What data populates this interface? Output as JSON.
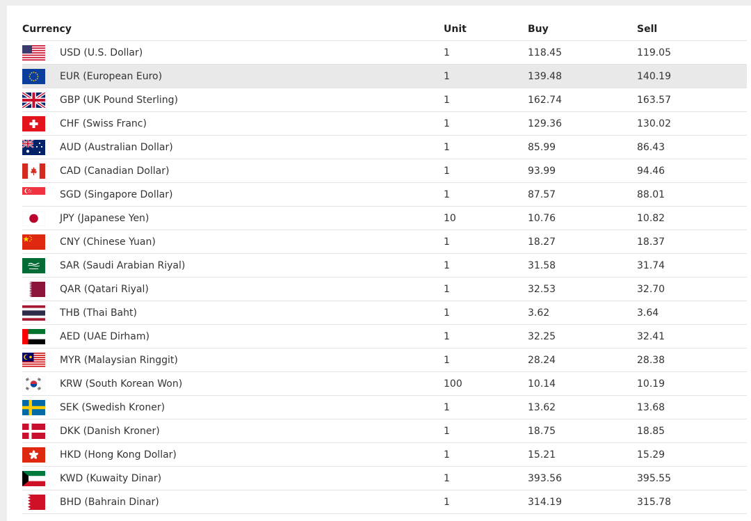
{
  "table": {
    "headers": {
      "currency": "Currency",
      "unit": "Unit",
      "buy": "Buy",
      "sell": "Sell"
    },
    "rows": [
      {
        "code": "usd",
        "currency": "USD (U.S. Dollar)",
        "unit": "1",
        "buy": "118.45",
        "sell": "119.05",
        "flag_icon": "us-flag-icon"
      },
      {
        "code": "eur",
        "currency": "EUR (European Euro)",
        "unit": "1",
        "buy": "139.48",
        "sell": "140.19",
        "flag_icon": "eu-flag-icon"
      },
      {
        "code": "gbp",
        "currency": "GBP (UK Pound Sterling)",
        "unit": "1",
        "buy": "162.74",
        "sell": "163.57",
        "flag_icon": "uk-flag-icon"
      },
      {
        "code": "chf",
        "currency": "CHF (Swiss Franc)",
        "unit": "1",
        "buy": "129.36",
        "sell": "130.02",
        "flag_icon": "swiss-flag-icon"
      },
      {
        "code": "aud",
        "currency": "AUD (Australian Dollar)",
        "unit": "1",
        "buy": "85.99",
        "sell": "86.43",
        "flag_icon": "australia-flag-icon"
      },
      {
        "code": "cad",
        "currency": "CAD (Canadian Dollar)",
        "unit": "1",
        "buy": "93.99",
        "sell": "94.46",
        "flag_icon": "canada-flag-icon"
      },
      {
        "code": "sgd",
        "currency": "SGD (Singapore Dollar)",
        "unit": "1",
        "buy": "87.57",
        "sell": "88.01",
        "flag_icon": "singapore-flag-icon"
      },
      {
        "code": "jpy",
        "currency": "JPY (Japanese Yen)",
        "unit": "10",
        "buy": "10.76",
        "sell": "10.82",
        "flag_icon": "japan-flag-icon"
      },
      {
        "code": "cny",
        "currency": "CNY (Chinese Yuan)",
        "unit": "1",
        "buy": "18.27",
        "sell": "18.37",
        "flag_icon": "china-flag-icon"
      },
      {
        "code": "sar",
        "currency": "SAR (Saudi Arabian Riyal)",
        "unit": "1",
        "buy": "31.58",
        "sell": "31.74",
        "flag_icon": "saudi-arabia-flag-icon"
      },
      {
        "code": "qar",
        "currency": "QAR (Qatari Riyal)",
        "unit": "1",
        "buy": "32.53",
        "sell": "32.70",
        "flag_icon": "qatar-flag-icon"
      },
      {
        "code": "thb",
        "currency": "THB (Thai Baht)",
        "unit": "1",
        "buy": "3.62",
        "sell": "3.64",
        "flag_icon": "thailand-flag-icon"
      },
      {
        "code": "aed",
        "currency": "AED (UAE Dirham)",
        "unit": "1",
        "buy": "32.25",
        "sell": "32.41",
        "flag_icon": "uae-flag-icon"
      },
      {
        "code": "myr",
        "currency": "MYR (Malaysian Ringgit)",
        "unit": "1",
        "buy": "28.24",
        "sell": "28.38",
        "flag_icon": "malaysia-flag-icon"
      },
      {
        "code": "krw",
        "currency": "KRW (South Korean Won)",
        "unit": "100",
        "buy": "10.14",
        "sell": "10.19",
        "flag_icon": "south-korea-flag-icon"
      },
      {
        "code": "sek",
        "currency": "SEK (Swedish Kroner)",
        "unit": "1",
        "buy": "13.62",
        "sell": "13.68",
        "flag_icon": "sweden-flag-icon"
      },
      {
        "code": "dkk",
        "currency": "DKK (Danish Kroner)",
        "unit": "1",
        "buy": "18.75",
        "sell": "18.85",
        "flag_icon": "denmark-flag-icon"
      },
      {
        "code": "hkd",
        "currency": "HKD (Hong Kong Dollar)",
        "unit": "1",
        "buy": "15.21",
        "sell": "15.29",
        "flag_icon": "hong-kong-flag-icon"
      },
      {
        "code": "kwd",
        "currency": "KWD (Kuwaity Dinar)",
        "unit": "1",
        "buy": "393.56",
        "sell": "395.55",
        "flag_icon": "kuwait-flag-icon"
      },
      {
        "code": "bhd",
        "currency": "BHD (Bahrain Dinar)",
        "unit": "1",
        "buy": "314.19",
        "sell": "315.78",
        "flag_icon": "bahrain-flag-icon"
      }
    ],
    "highlighted_row": 1
  },
  "colors": {
    "header_text": "#222222",
    "cell_text": "#333333",
    "row_border": "#e3e3e3",
    "highlight_row": "#e9e9e9",
    "page_background": "#eeeeee"
  }
}
